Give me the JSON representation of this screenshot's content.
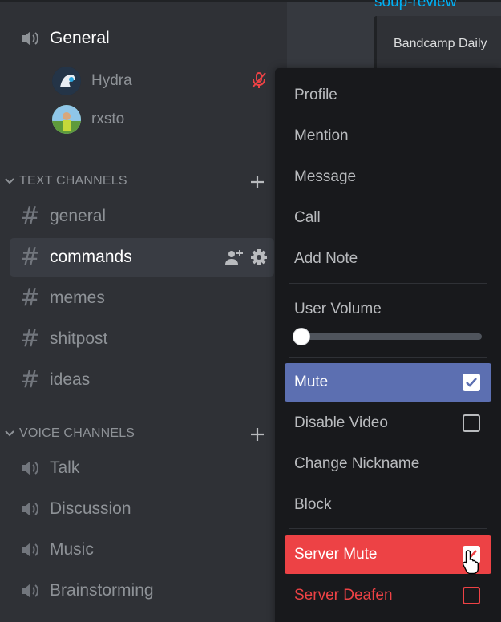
{
  "main": {
    "channel_link": "soup-review",
    "embed_text": "Bandcamp Daily"
  },
  "sidebar": {
    "voice_active": {
      "name": "General",
      "icon": "speaker-icon",
      "users": [
        {
          "name": "Hydra",
          "muted": true
        },
        {
          "name": "rxsto",
          "muted": false
        }
      ]
    },
    "text_category": "TEXT CHANNELS",
    "text_channels": [
      {
        "name": "general"
      },
      {
        "name": "commands",
        "active": true
      },
      {
        "name": "memes"
      },
      {
        "name": "shitpost"
      },
      {
        "name": "ideas"
      }
    ],
    "voice_category": "VOICE CHANNELS",
    "voice_channels": [
      {
        "name": "Talk"
      },
      {
        "name": "Discussion"
      },
      {
        "name": "Music"
      },
      {
        "name": "Brainstorming"
      }
    ]
  },
  "menu": {
    "items": [
      "Profile",
      "Mention",
      "Message",
      "Call",
      "Add Note"
    ],
    "user_volume_label": "User Volume",
    "user_volume_level": 0,
    "mute": {
      "label": "Mute",
      "checked": true
    },
    "disable_video": {
      "label": "Disable Video",
      "checked": false
    },
    "change_nickname": "Change Nickname",
    "block": "Block",
    "server_mute": {
      "label": "Server Mute",
      "checked": true
    },
    "server_deafen": {
      "label": "Server Deafen",
      "checked": false
    }
  },
  "colors": {
    "accent": "#5c6fb1",
    "danger": "#ed4245",
    "link": "#00b0f4"
  }
}
